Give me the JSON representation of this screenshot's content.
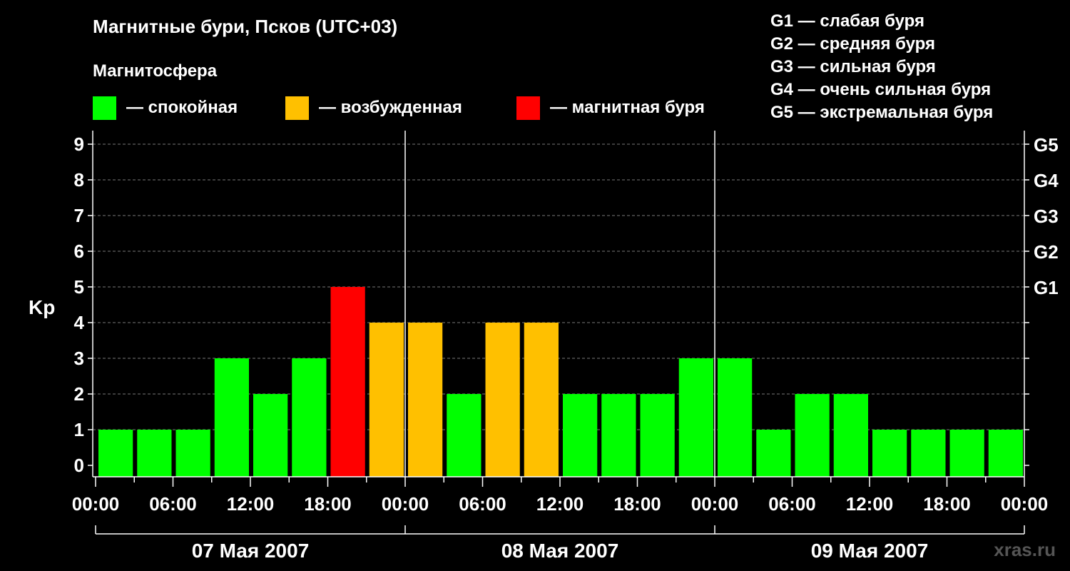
{
  "title": "Магнитные бури, Псков (UTC+03)",
  "subtitle": "Магнитосфера",
  "legend": [
    {
      "label": "— спокойная",
      "color": "#00ff00"
    },
    {
      "label": "— возбужденная",
      "color": "#ffc000"
    },
    {
      "label": "— магнитная буря",
      "color": "#ff0000"
    }
  ],
  "storm_scale": [
    "G1 — слабая буря",
    "G2 — средняя буря",
    "G3 — сильная буря",
    "G4 — очень сильная буря",
    "G5 — экстремальная буря"
  ],
  "watermark": "xras.ru",
  "chart_data": {
    "type": "bar",
    "ylabel": "Kp",
    "ylim": [
      0,
      9
    ],
    "y_ticks": [
      "0",
      "1",
      "2",
      "3",
      "4",
      "5",
      "6",
      "7",
      "8",
      "9"
    ],
    "right_ticks": [
      {
        "value": 5,
        "label": "G1"
      },
      {
        "value": 6,
        "label": "G2"
      },
      {
        "value": 7,
        "label": "G3"
      },
      {
        "value": 8,
        "label": "G4"
      },
      {
        "value": 9,
        "label": "G5"
      }
    ],
    "x_tick_labels": [
      "00:00",
      "06:00",
      "12:00",
      "18:00",
      "00:00",
      "06:00",
      "12:00",
      "18:00",
      "00:00",
      "06:00",
      "12:00",
      "18:00",
      "00:00"
    ],
    "days": [
      "07 Мая 2007",
      "08 Мая 2007",
      "09 Мая 2007"
    ],
    "grid": "dashed horizontal at each Kp level",
    "values": [
      1,
      1,
      1,
      3,
      2,
      3,
      5,
      4,
      4,
      2,
      4,
      4,
      2,
      2,
      2,
      3,
      3,
      1,
      2,
      2,
      1,
      1,
      1,
      1
    ],
    "colors": [
      "#00ff00",
      "#00ff00",
      "#00ff00",
      "#00ff00",
      "#00ff00",
      "#00ff00",
      "#ff0000",
      "#ffc000",
      "#ffc000",
      "#00ff00",
      "#ffc000",
      "#ffc000",
      "#00ff00",
      "#00ff00",
      "#00ff00",
      "#00ff00",
      "#00ff00",
      "#00ff00",
      "#00ff00",
      "#00ff00",
      "#00ff00",
      "#00ff00",
      "#00ff00",
      "#00ff00"
    ],
    "interval_hours": 3
  }
}
